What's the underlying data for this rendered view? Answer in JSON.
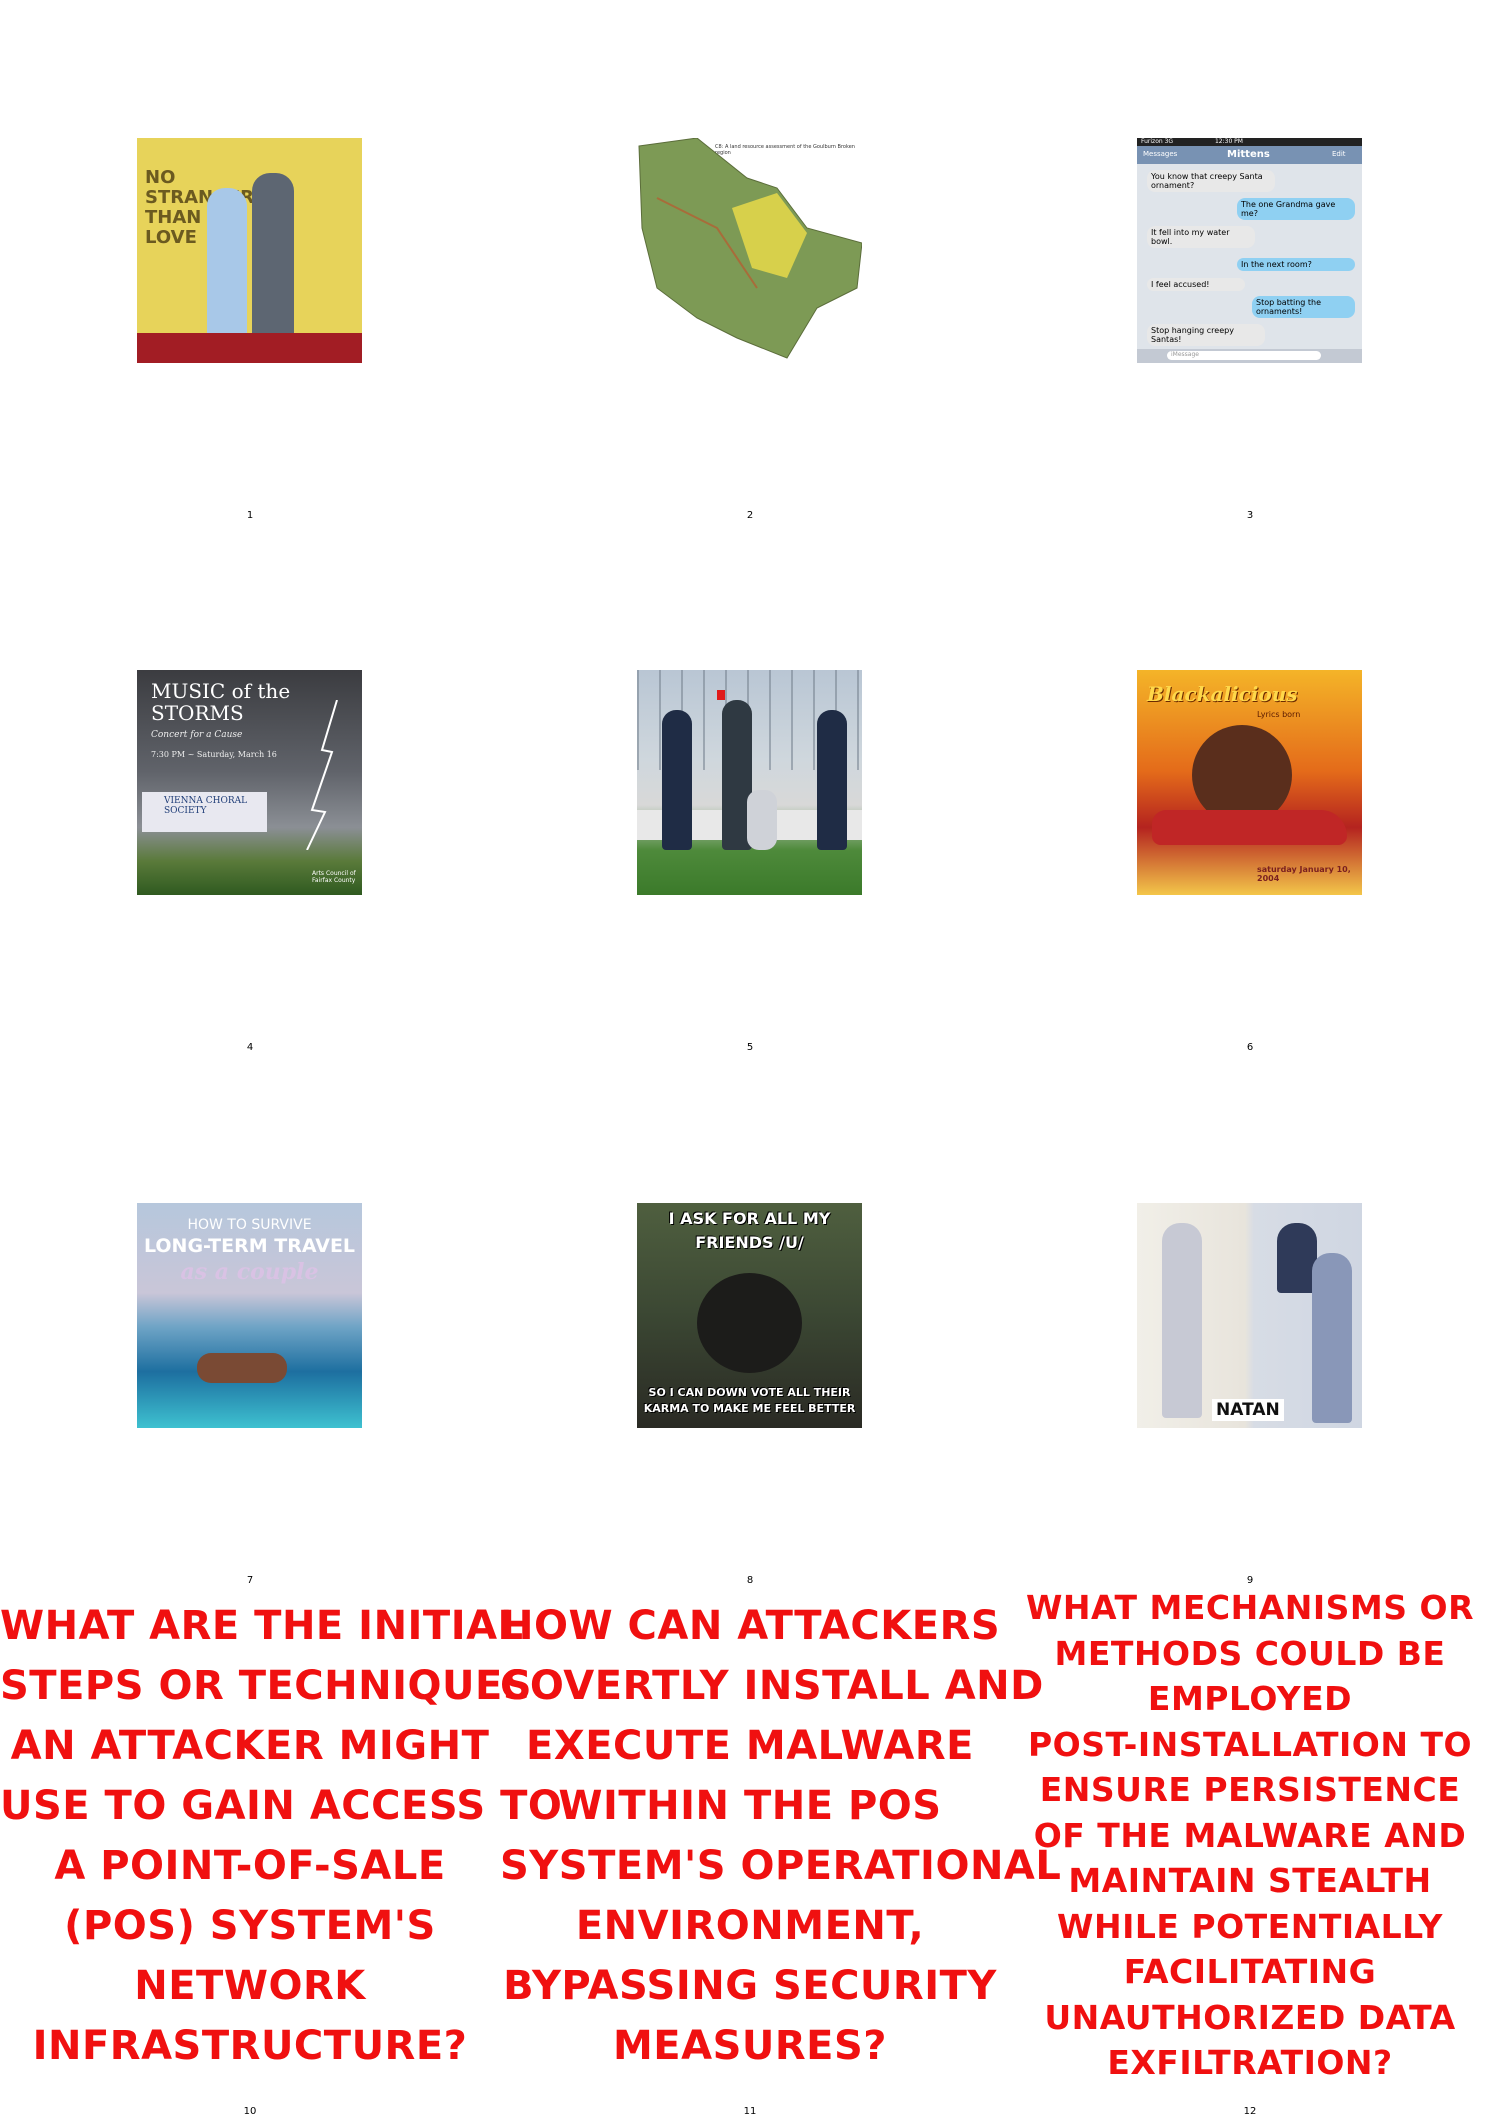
{
  "items": [
    {
      "number": "1",
      "caption": "NO STRANGER THAN LOVE"
    },
    {
      "number": "2",
      "caption": "C8: A land resource assessment of the Goulburn Broken region"
    },
    {
      "number": "3",
      "sender": "Mittens",
      "carrier": "Furizon 3G",
      "time": "12:30 PM",
      "back": "Messages",
      "edit": "Edit",
      "bubbles": [
        "You know that creepy Santa ornament?",
        "The one Grandma gave me?",
        "It fell into my water bowl.",
        "In the next room?",
        "I feel accused!",
        "Stop batting the ornaments!",
        "Stop hanging creepy Santas!"
      ],
      "input": "iMessage"
    },
    {
      "number": "4",
      "title": "MUSIC of the STORMS",
      "sub": "Concert for a Cause",
      "date": "7:30 PM ~ Saturday, March 16",
      "org": "VIENNA CHORAL SOCIETY",
      "sponsor": "Arts Council of Fairfax County"
    },
    {
      "number": "5"
    },
    {
      "number": "6",
      "title": "Blackalicious",
      "sub": "Lyrics born",
      "date": "saturday January 10, 2004"
    },
    {
      "number": "7",
      "line1": "HOW TO SURVIVE",
      "line2": "LONG-TERM TRAVEL",
      "line3": "as a couple"
    },
    {
      "number": "8",
      "top": "I ASK FOR ALL MY FRIENDS /U/",
      "bottom": "SO I CAN DOWN VOTE ALL THEIR KARMA TO MAKE ME FEEL BETTER"
    },
    {
      "number": "9",
      "label": "NATAN"
    }
  ],
  "questions": [
    {
      "number": "10",
      "lines": [
        "WHAT ARE THE INITIAL",
        "STEPS OR TECHNIQUES",
        "AN ATTACKER MIGHT",
        "USE TO GAIN ACCESS TO",
        "A POINT-OF-SALE",
        "(POS) SYSTEM'S",
        "NETWORK",
        "INFRASTRUCTURE?"
      ]
    },
    {
      "number": "11",
      "lines": [
        "HOW CAN ATTACKERS",
        "COVERTLY INSTALL AND",
        "EXECUTE MALWARE",
        "WITHIN THE POS",
        "SYSTEM'S OPERATIONAL",
        "ENVIRONMENT,",
        "BYPASSING SECURITY",
        "MEASURES?"
      ]
    },
    {
      "number": "12",
      "lines": [
        "WHAT MECHANISMS OR",
        "METHODS COULD BE",
        "EMPLOYED",
        "POST-INSTALLATION TO",
        "ENSURE PERSISTENCE",
        "OF THE MALWARE AND",
        "MAINTAIN STEALTH",
        "WHILE POTENTIALLY",
        "FACILITATING",
        "UNAUTHORIZED DATA",
        "EXFILTRATION?"
      ]
    }
  ]
}
